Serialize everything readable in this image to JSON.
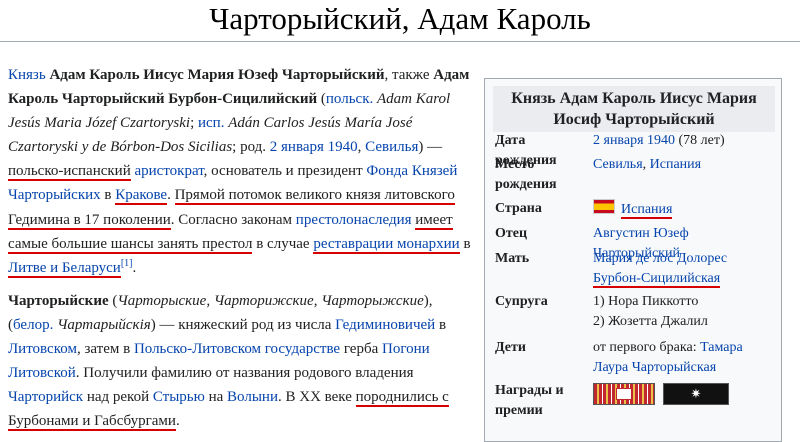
{
  "page_title": "Чарторыйский, Адам Кароль",
  "article": {
    "p1": {
      "t01": "Князь",
      "t02": "Адам Кароль Иисус Мария Юзеф Чарторыйский",
      "t03": ", также",
      "t04": "Адам Кароль Чарторыйский Бурбон-Сицилийский",
      "t05": " (",
      "t06": "польск.",
      "t07": "Adam Karol Jesús Maria Józef Czartoryski",
      "t08": "; ",
      "t09": "исп.",
      "t10": "Adán Carlos Jesús María José Czartoryski y de Bórbon-Dos Sicilias",
      "t11": "; род. ",
      "t12": "2 января 1940",
      "t13": ", ",
      "t14": "Севилья",
      "t15": ") —",
      "t16": "польско-испанский",
      "t17": "аристократ",
      "t18": ", основатель и президент ",
      "t19": "Фонда Князей Чарторыйских",
      "t20": " в ",
      "t21": "Кракове",
      "t22": ". ",
      "t23": "Прямой потомок великого князя литовского Гедимина в 17 поколении",
      "t24": ". Согласно законам ",
      "t25": "престолонаследия",
      "t26": " ",
      "t27": "имеет самые большие шансы занять престол",
      "t28": " в случае ",
      "t29": "реставрации монархии",
      "t30": " в ",
      "t31": "Литве и Беларуси",
      "t32": "[1]",
      "t33": "."
    },
    "p2": {
      "t01": "Чарторыйские",
      "t02": " (",
      "t03": "Чарторыские, Чарторижские, Чарторыжские",
      "t04": "), (",
      "t05": "белор.",
      "t06": "Чартарыйскія",
      "t07": ") — княжеский род из числа ",
      "t08": "Гедиминовичей",
      "t09": " в ",
      "t10": "Литовском",
      "t11": ", затем в ",
      "t12": "Польско-Литовском государстве",
      "t13": " герба ",
      "t14": "Погони Литовской",
      "t15": ". Получили фамилию от названия родового владения ",
      "t16": "Чарторийск",
      "t17": " над рекой ",
      "t18": "Стырью",
      "t19": " на ",
      "t20": "Волыни",
      "t21": ". В XX веке ",
      "t22": "породнились с Бурбонами и Габсбургами",
      "t23": "."
    }
  },
  "infobox": {
    "header": "Князь Адам Кароль Иисус Мария Иосиф Чарторыйский",
    "rows": [
      {
        "label": "Дата рождения",
        "value_link": "2 января 1940",
        "value_rest": " (78 лет)"
      },
      {
        "label": "Место рождения",
        "value_link": "Севилья",
        "value_sep": ", ",
        "value_link2": "Испания"
      },
      {
        "label": "Страна",
        "value_link": "Испания",
        "flag_icon": "spain-flag-icon"
      },
      {
        "label": "Отец",
        "value_link": "Августин Юзеф Чарторыйский"
      },
      {
        "label": "Мать",
        "value_link": "Мария де лос Долорес",
        "value_sep": " ",
        "value_link2": "Бурбон-Сицилийская"
      },
      {
        "label": "Супруга",
        "line1": "1) Нора Пиккотто",
        "line2": "2) Жозетта Джалил"
      },
      {
        "label": "Дети",
        "value_prefix": "от первого брака: ",
        "value_link": "Тамара Лаура Чарторыйская"
      },
      {
        "label": "Награды и премии",
        "ribbon_icons": [
          "order-ribbon-icon",
          "star-order-ribbon-icon"
        ],
        "ribbon2_glyph": "✷"
      }
    ]
  },
  "colors": {
    "link": "#0645ad",
    "underline": "#d60000",
    "infobox_bg": "#f8f9fa",
    "infobox_header_bg": "#eaecf0"
  }
}
